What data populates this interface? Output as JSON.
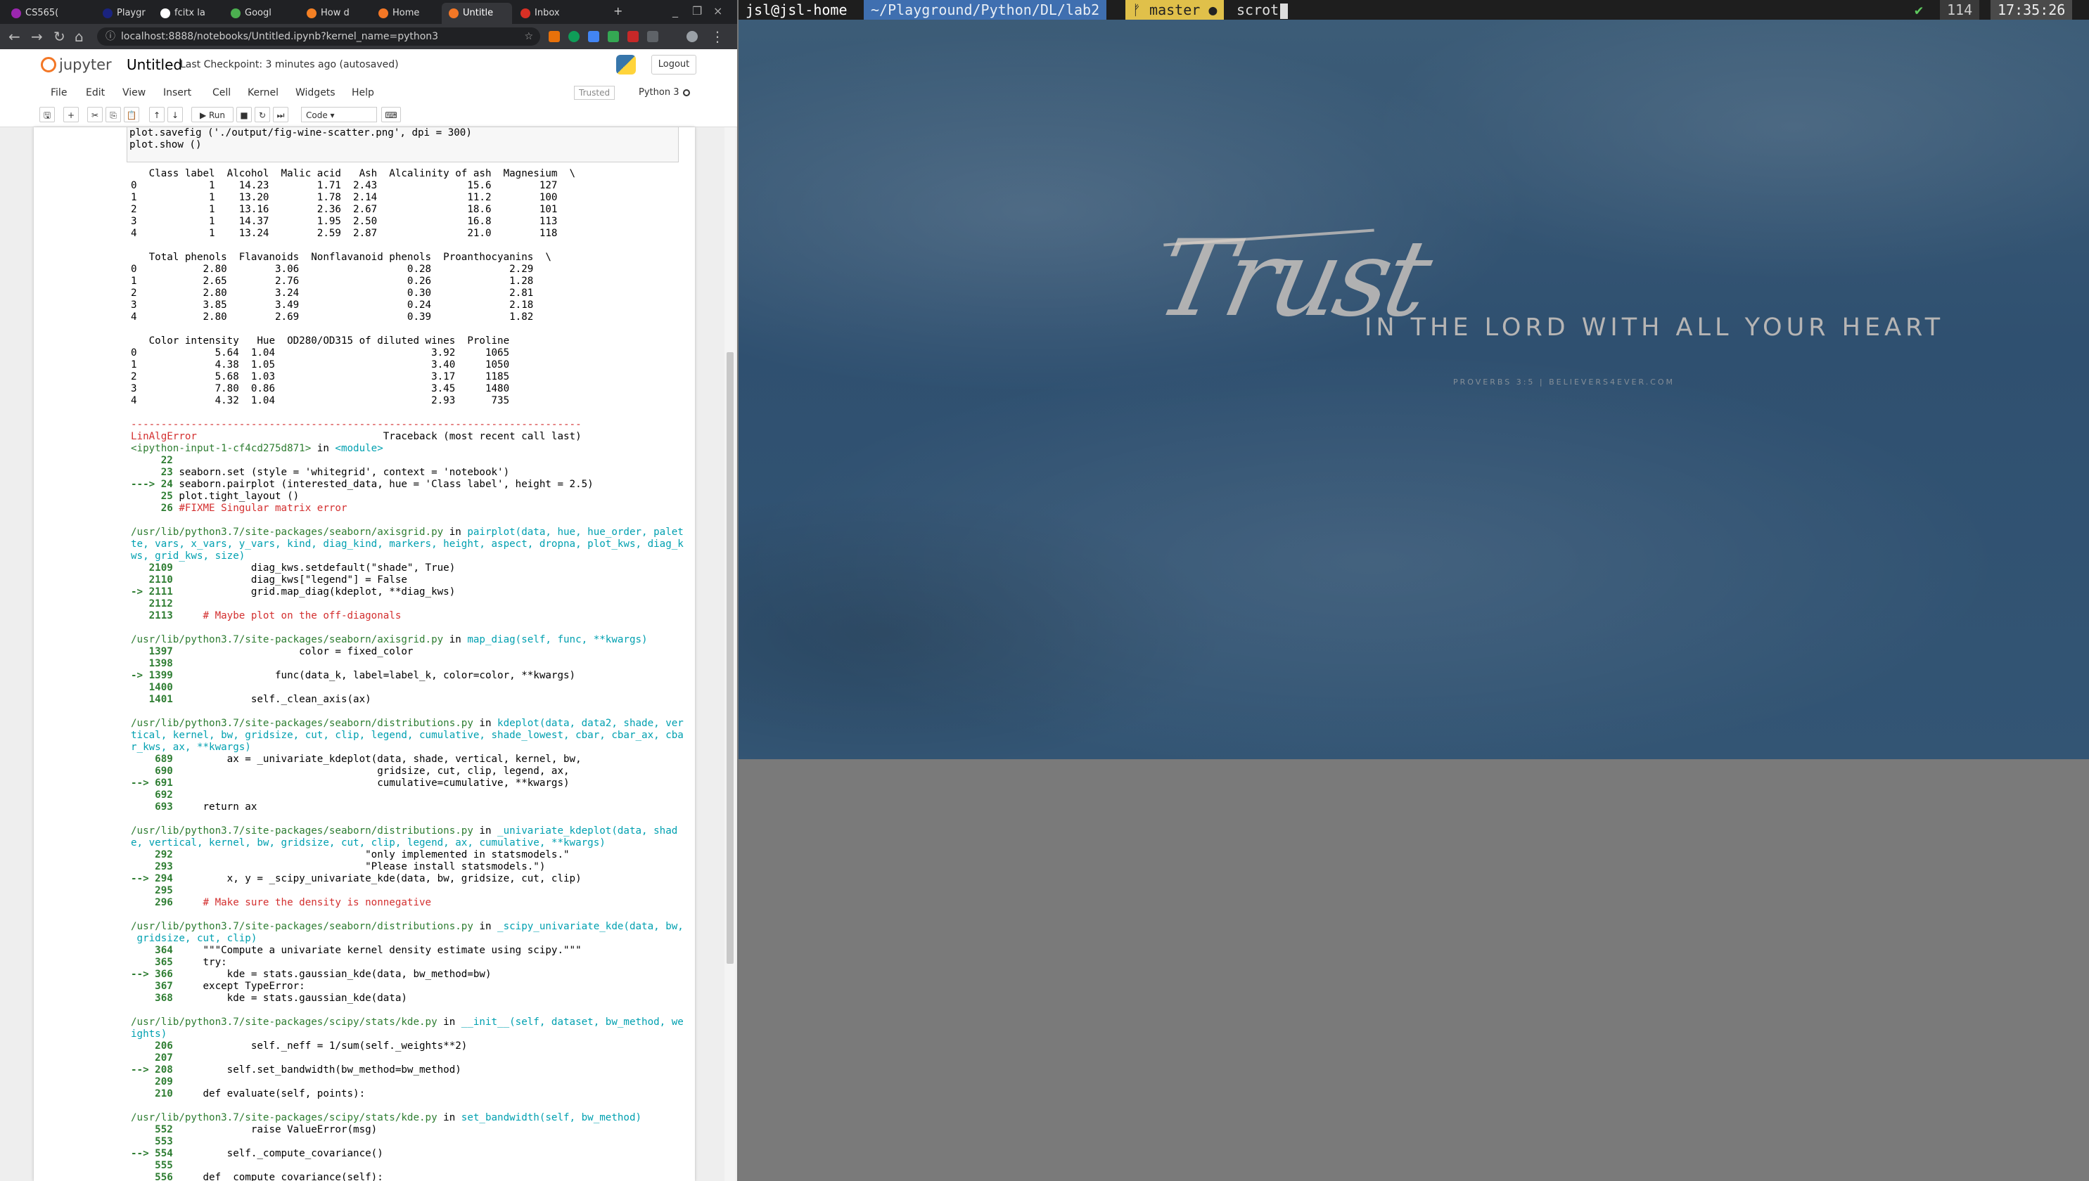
{
  "browser": {
    "tabs": [
      {
        "label": "CS565(",
        "favicon_color": "#9c27b0"
      },
      {
        "label": "Playgr",
        "favicon_color": "#1a237e"
      },
      {
        "label": "fcitx la",
        "favicon_color": "#ffffff"
      },
      {
        "label": "Googl",
        "favicon_color": "#4caf50"
      },
      {
        "label": "How d",
        "favicon_color": "#f48024"
      },
      {
        "label": "Home",
        "favicon_color": "#f37726"
      },
      {
        "label": "Untitle",
        "favicon_color": "#f37726"
      },
      {
        "label": "Inbox",
        "favicon_color": "#d93025"
      }
    ],
    "new_tab": "+",
    "window_controls": [
      "_",
      "❐",
      "×"
    ],
    "url": "localhost:8888/notebooks/Untitled.ipynb?kernel_name=python3"
  },
  "jupyter": {
    "logo_text": "jupyter",
    "notebook_title": "Untitled",
    "checkpoint": "Last Checkpoint: 3 minutes ago  (autosaved)",
    "logout": "Logout",
    "menus": [
      "File",
      "Edit",
      "View",
      "Insert",
      "Cell",
      "Kernel",
      "Widgets",
      "Help"
    ],
    "trusted": "Trusted",
    "kernel_name": "Python 3",
    "run_label": "▶ Run",
    "cell_type": "Code"
  },
  "cell": {
    "input_code": "plot.savefig ('./output/fig-wine-scatter.png', dpi = 300)\nplot.show ()",
    "df_output": "   Class label  Alcohol  Malic acid   Ash  Alcalinity of ash  Magnesium  \\\n0            1    14.23        1.71  2.43               15.6        127\n1            1    13.20        1.78  2.14               11.2        100\n2            1    13.16        2.36  2.67               18.6        101\n3            1    14.37        1.95  2.50               16.8        113\n4            1    13.24        2.59  2.87               21.0        118\n\n   Total phenols  Flavanoids  Nonflavanoid phenols  Proanthocyanins  \\\n0           2.80        3.06                  0.28             2.29\n1           2.65        2.76                  0.26             1.28\n2           2.80        3.24                  0.30             2.81\n3           3.85        3.49                  0.24             2.18\n4           2.80        2.69                  0.39             1.82\n\n   Color intensity   Hue  OD280/OD315 of diluted wines  Proline\n0             5.64  1.04                          3.92     1065\n1             4.38  1.05                          3.40     1050\n2             5.68  1.03                          3.17     1185\n3             7.80  0.86                          3.45     1480\n4             4.32  1.04                          2.93      735",
    "tb_rule": "---------------------------------------------------------------------------",
    "tb_error": "LinAlgError",
    "tb_head": "                               Traceback (most recent call last)",
    "tb_input": "<ipython-input-1-cf4cd275d871>",
    "tb_in": " in ",
    "tb_module": "<module>",
    "f0": {
      "lines": [
        {
          "no": "     22",
          "code": ""
        },
        {
          "no": "     23",
          "code": " seaborn.set (style = 'whitegrid', context = 'notebook')"
        },
        {
          "no": "---> 24",
          "code": " seaborn.pairplot (interested_data, hue = 'Class label', height = 2.5)"
        },
        {
          "no": "     25",
          "code": " plot.tight_layout ()"
        },
        {
          "no": "     26",
          "code": " #FIXME Singular matrix error"
        }
      ]
    },
    "frames": [
      {
        "path": "/usr/lib/python3.7/site-packages/seaborn/axisgrid.py",
        "sig": "pairplot(data, hue, hue_order, palet\nte, vars, x_vars, y_vars, kind, diag_kind, markers, height, aspect, dropna, plot_kws, diag_k\nws, grid_kws, size)",
        "lines": [
          {
            "no": "   2109",
            "code": "             diag_kws.setdefault(\"shade\", True)"
          },
          {
            "no": "   2110",
            "code": "             diag_kws[\"legend\"] = False"
          },
          {
            "no": "-> 2111",
            "code": "             grid.map_diag(kdeplot, **diag_kws)"
          },
          {
            "no": "   2112",
            "code": ""
          },
          {
            "no": "   2113",
            "code": "     # Maybe plot on the off-diagonals"
          }
        ]
      },
      {
        "path": "/usr/lib/python3.7/site-packages/seaborn/axisgrid.py",
        "sig": "map_diag(self, func, **kwargs)",
        "lines": [
          {
            "no": "   1397",
            "code": "                     color = fixed_color"
          },
          {
            "no": "   1398",
            "code": ""
          },
          {
            "no": "-> 1399",
            "code": "                 func(data_k, label=label_k, color=color, **kwargs)"
          },
          {
            "no": "   1400",
            "code": ""
          },
          {
            "no": "   1401",
            "code": "             self._clean_axis(ax)"
          }
        ]
      },
      {
        "path": "/usr/lib/python3.7/site-packages/seaborn/distributions.py",
        "sig": "kdeplot(data, data2, shade, ver\ntical, kernel, bw, gridsize, cut, clip, legend, cumulative, shade_lowest, cbar, cbar_ax, cba\nr_kws, ax, **kwargs)",
        "lines": [
          {
            "no": "    689",
            "code": "         ax = _univariate_kdeplot(data, shade, vertical, kernel, bw,"
          },
          {
            "no": "    690",
            "code": "                                  gridsize, cut, clip, legend, ax,"
          },
          {
            "no": "--> 691",
            "code": "                                  cumulative=cumulative, **kwargs)"
          },
          {
            "no": "    692",
            "code": ""
          },
          {
            "no": "    693",
            "code": "     return ax"
          }
        ]
      },
      {
        "path": "/usr/lib/python3.7/site-packages/seaborn/distributions.py",
        "sig": "_univariate_kdeplot(data, shad\ne, vertical, kernel, bw, gridsize, cut, clip, legend, ax, cumulative, **kwargs)",
        "lines": [
          {
            "no": "    292",
            "code": "                                \"only implemented in statsmodels.\""
          },
          {
            "no": "    293",
            "code": "                                \"Please install statsmodels.\")"
          },
          {
            "no": "--> 294",
            "code": "         x, y = _scipy_univariate_kde(data, bw, gridsize, cut, clip)"
          },
          {
            "no": "    295",
            "code": ""
          },
          {
            "no": "    296",
            "code": "     # Make sure the density is nonnegative"
          }
        ]
      },
      {
        "path": "/usr/lib/python3.7/site-packages/seaborn/distributions.py",
        "sig": "_scipy_univariate_kde(data, bw,\n gridsize, cut, clip)",
        "lines": [
          {
            "no": "    364",
            "code": "     \"\"\"Compute a univariate kernel density estimate using scipy.\"\"\""
          },
          {
            "no": "    365",
            "code": "     try:"
          },
          {
            "no": "--> 366",
            "code": "         kde = stats.gaussian_kde(data, bw_method=bw)"
          },
          {
            "no": "    367",
            "code": "     except TypeError:"
          },
          {
            "no": "    368",
            "code": "         kde = stats.gaussian_kde(data)"
          }
        ]
      },
      {
        "path": "/usr/lib/python3.7/site-packages/scipy/stats/kde.py",
        "sig": "__init__(self, dataset, bw_method, we\nights)",
        "lines": [
          {
            "no": "    206",
            "code": "             self._neff = 1/sum(self._weights**2)"
          },
          {
            "no": "    207",
            "code": ""
          },
          {
            "no": "--> 208",
            "code": "         self.set_bandwidth(bw_method=bw_method)"
          },
          {
            "no": "    209",
            "code": ""
          },
          {
            "no": "    210",
            "code": "     def evaluate(self, points):"
          }
        ]
      },
      {
        "path": "/usr/lib/python3.7/site-packages/scipy/stats/kde.py",
        "sig": "set_bandwidth(self, bw_method)",
        "lines": [
          {
            "no": "    552",
            "code": "             raise ValueError(msg)"
          },
          {
            "no": "    553",
            "code": ""
          },
          {
            "no": "--> 554",
            "code": "         self._compute_covariance()"
          },
          {
            "no": "    555",
            "code": ""
          },
          {
            "no": "    556",
            "code": "     def _compute_covariance(self):"
          }
        ]
      }
    ]
  },
  "desktop": {
    "wallpaper_word": "Trust",
    "wallpaper_verse": "IN THE LORD WITH ALL YOUR HEART",
    "wallpaper_source": "PROVERBS 3:5 | BELIEVERS4EVER.COM",
    "prompt_user": "jsl@jsl-home",
    "prompt_path": "~/Playground/Python/DL/lab2",
    "prompt_git": "ᚠ master ●",
    "prompt_cmd": "scrot",
    "status_ok": "✔",
    "status_num": "114",
    "status_time": "17:35:26"
  }
}
